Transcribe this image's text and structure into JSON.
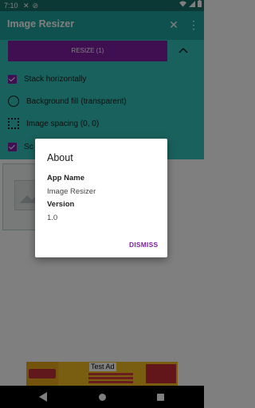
{
  "status_bar": {
    "time": "7:10"
  },
  "app_bar": {
    "title": "Image Resizer"
  },
  "panel": {
    "resize_label": "RESIZE (1)",
    "options": [
      {
        "label": "Stack horizontally",
        "control": "checkbox",
        "checked": true
      },
      {
        "label": "Background fill (transparent)",
        "control": "circle",
        "checked": false
      },
      {
        "label": "Image spacing (0, 0)",
        "control": "grid",
        "checked": false
      },
      {
        "label": "Sc",
        "control": "checkbox",
        "checked": true
      }
    ]
  },
  "dialog": {
    "title": "About",
    "app_name_label": "App Name",
    "app_name_value": "Image Resizer",
    "version_label": "Version",
    "version_value": "1.0",
    "dismiss_label": "DISMISS"
  },
  "ad": {
    "test_label": "Test Ad"
  },
  "colors": {
    "primary_dark": "#176f69",
    "primary": "#1fa39c",
    "panel": "#33c3bb",
    "accent": "#7e1fa2"
  }
}
